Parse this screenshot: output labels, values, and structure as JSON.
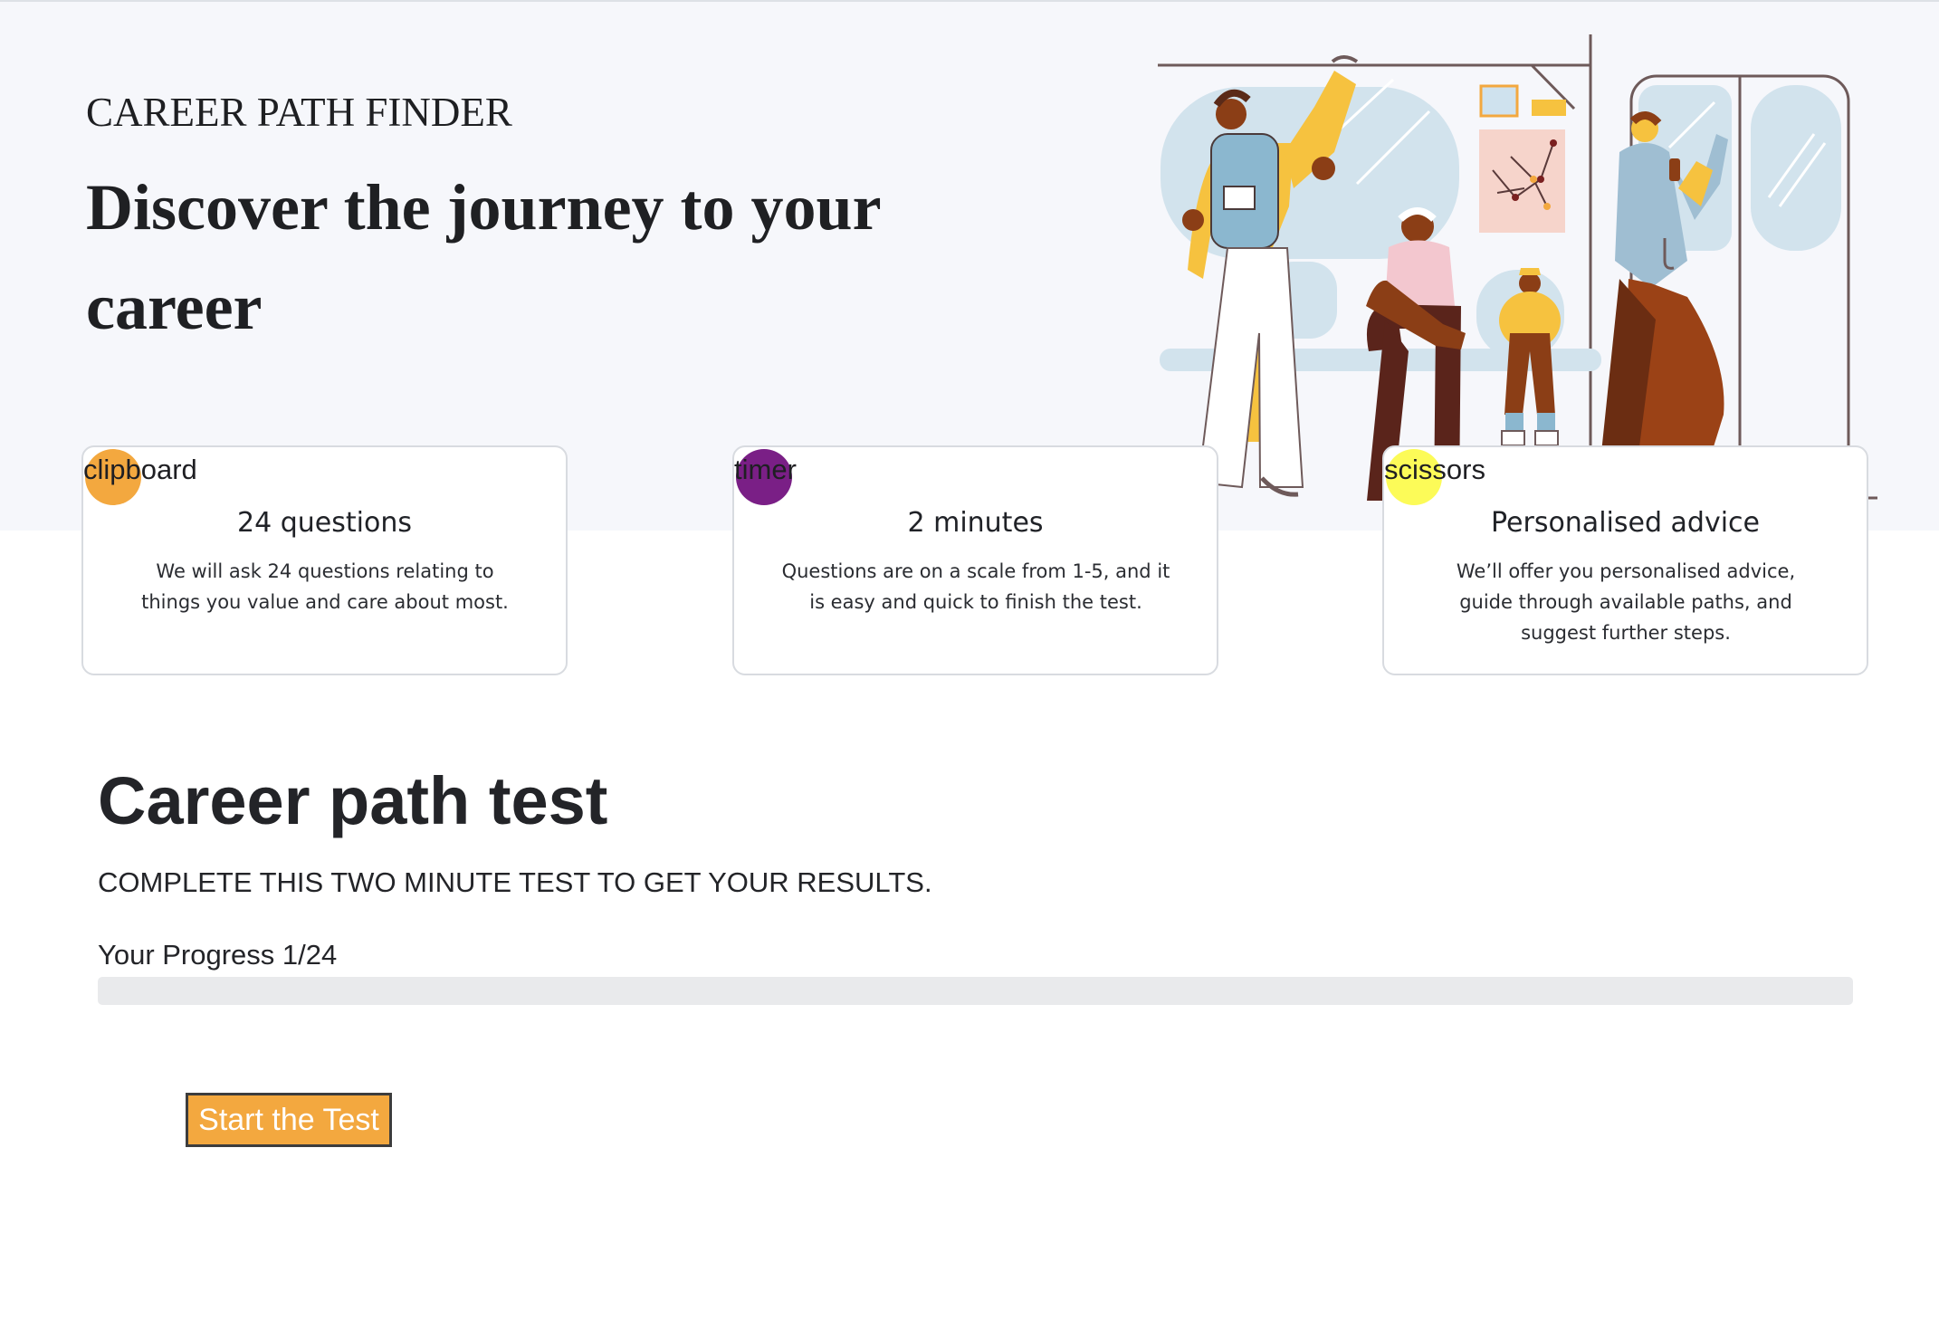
{
  "hero": {
    "brand": "CAREER PATH FINDER",
    "title": "Discover the journey to your career"
  },
  "colors": {
    "accent_orange": "#f3a83f",
    "accent_purple": "#7a1f86",
    "accent_yellow": "#fcfb58",
    "hero_background": "#f6f7fb",
    "progress_track": "#e9eaec",
    "button_border": "#3d3d3d"
  },
  "cards": [
    {
      "icon": "clipboard",
      "icon_label": "clipboard",
      "badge_color": "#f3a83f",
      "title": "24 questions",
      "description": "We will ask 24 questions relating to things you value and care about most."
    },
    {
      "icon": "timer",
      "icon_label": "timer",
      "badge_color": "#7a1f86",
      "title": "2 minutes",
      "description": "Questions are on a scale from 1-5, and it is easy and quick to finish the test."
    },
    {
      "icon": "scissors",
      "icon_label": "scissors",
      "badge_color": "#fcfb58",
      "title": "Personalised advice",
      "description": "We’ll offer you personalised advice, guide through available paths, and suggest further steps."
    }
  ],
  "test": {
    "title": "Career path test",
    "subtitle": "COMPLETE THIS TWO MINUTE TEST TO GET YOUR RESULTS.",
    "progress_label": "Your Progress 1/24",
    "progress_current": 1,
    "progress_total": 24,
    "progress_fill_fraction": 0,
    "start_button_label": "Start the Test"
  }
}
